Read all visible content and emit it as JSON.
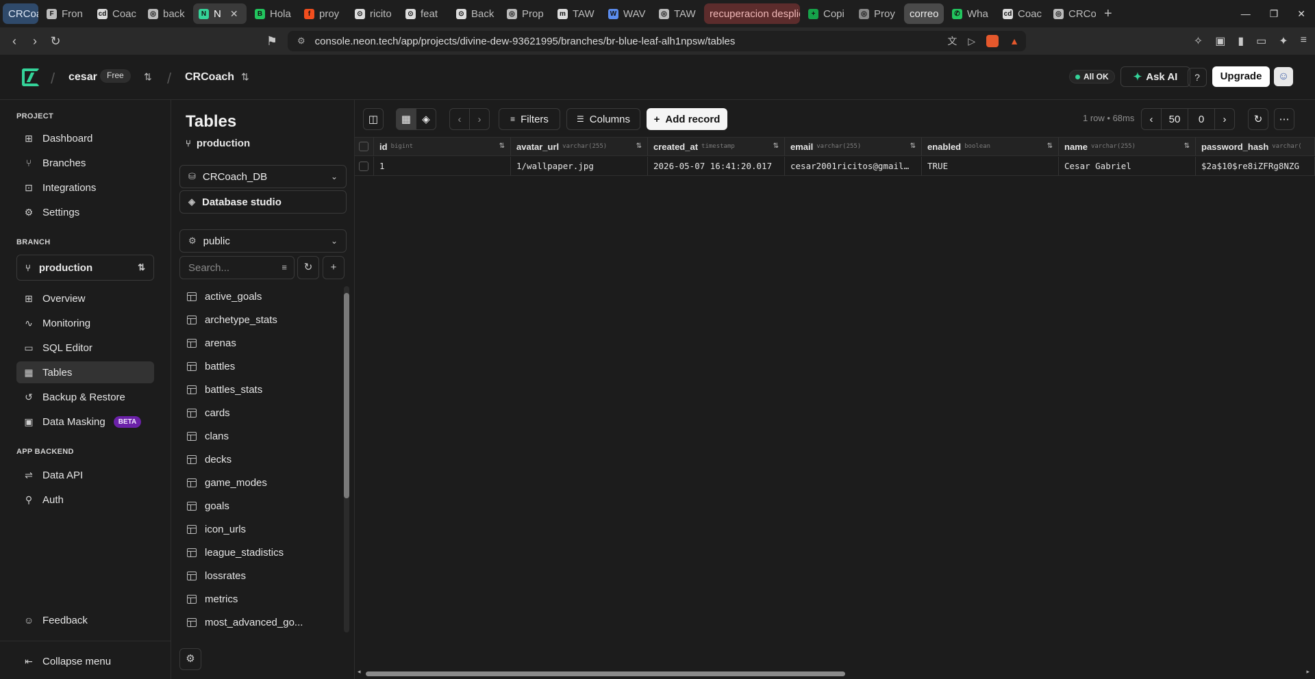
{
  "browser": {
    "tabs": [
      {
        "label": "CRCoach",
        "style": "group-blue",
        "fav": ""
      },
      {
        "label": "Fron",
        "style": "",
        "fav": "F",
        "favColor": "#bbbbbb"
      },
      {
        "label": "Coac",
        "style": "",
        "fav": "cd",
        "favColor": "#dddddd"
      },
      {
        "label": "back",
        "style": "",
        "fav": "◎",
        "favColor": "#bbbbbb"
      },
      {
        "label": "N",
        "style": "active",
        "fav": "N",
        "favColor": "#34d399"
      },
      {
        "label": "Hola",
        "style": "",
        "fav": "B",
        "favColor": "#22c55e"
      },
      {
        "label": "proy",
        "style": "",
        "fav": "f",
        "favColor": "#f24e1e"
      },
      {
        "label": "ricito",
        "style": "",
        "fav": "⊙",
        "favColor": "#dddddd"
      },
      {
        "label": "feat",
        "style": "",
        "fav": "⊙",
        "favColor": "#dddddd"
      },
      {
        "label": "Back",
        "style": "",
        "fav": "⊙",
        "favColor": "#dddddd"
      },
      {
        "label": "Prop",
        "style": "",
        "fav": "◎",
        "favColor": "#bbbbbb"
      },
      {
        "label": "TAW",
        "style": "",
        "fav": "m",
        "favColor": "#dddddd"
      },
      {
        "label": "WAV",
        "style": "",
        "fav": "W",
        "favColor": "#5b8def"
      },
      {
        "label": "TAW",
        "style": "",
        "fav": "◎",
        "favColor": "#bbbbbb"
      },
      {
        "label": "recuperacion desplie",
        "style": "group-red",
        "fav": ""
      },
      {
        "label": "Copi",
        "style": "",
        "fav": "+",
        "favColor": "#16a34a"
      },
      {
        "label": "Proy",
        "style": "",
        "fav": "◎",
        "favColor": "#888888"
      },
      {
        "label": "correo",
        "style": "group-gray",
        "fav": ""
      },
      {
        "label": "Wha",
        "style": "",
        "fav": "✆",
        "favColor": "#22c55e"
      },
      {
        "label": "Coac",
        "style": "",
        "fav": "cd",
        "favColor": "#dddddd"
      },
      {
        "label": "CRCo",
        "style": "",
        "fav": "◎",
        "favColor": "#bbbbbb"
      }
    ],
    "url": "console.neon.tech/app/projects/divine-dew-93621995/branches/br-blue-leaf-alh1npsw/tables"
  },
  "header": {
    "org": "cesar",
    "plan_badge": "Free",
    "project": "CRCoach",
    "status": "All OK",
    "ask_ai": "Ask AI",
    "help": "?",
    "upgrade": "Upgrade"
  },
  "nav": {
    "project_section": "PROJECT",
    "project_items": [
      {
        "label": "Dashboard",
        "icon": "dashboard-icon"
      },
      {
        "label": "Branches",
        "icon": "branch-icon"
      },
      {
        "label": "Integrations",
        "icon": "integrations-icon"
      },
      {
        "label": "Settings",
        "icon": "gear-icon"
      }
    ],
    "branch_section": "BRANCH",
    "branch_selected": "production",
    "branch_items": [
      {
        "label": "Overview",
        "icon": "overview-icon"
      },
      {
        "label": "Monitoring",
        "icon": "monitoring-icon"
      },
      {
        "label": "SQL Editor",
        "icon": "sql-icon"
      },
      {
        "label": "Tables",
        "icon": "table-icon"
      },
      {
        "label": "Backup & Restore",
        "icon": "backup-icon"
      },
      {
        "label": "Data Masking",
        "icon": "mask-icon"
      }
    ],
    "beta_badge": "BETA",
    "backend_section": "APP BACKEND",
    "backend_items": [
      {
        "label": "Data API",
        "icon": "api-icon"
      },
      {
        "label": "Auth",
        "icon": "auth-icon"
      }
    ],
    "feedback": "Feedback",
    "collapse": "Collapse menu"
  },
  "tables_panel": {
    "title": "Tables",
    "branch": "production",
    "database": "CRCoach_DB",
    "studio": "Database studio",
    "schema": "public",
    "search_placeholder": "Search...",
    "tables": [
      "active_goals",
      "archetype_stats",
      "arenas",
      "battles",
      "battles_stats",
      "cards",
      "clans",
      "decks",
      "game_modes",
      "goals",
      "icon_urls",
      "league_stadistics",
      "lossrates",
      "metrics",
      "most_advanced_go..."
    ]
  },
  "toolbar": {
    "filters": "Filters",
    "columns": "Columns",
    "add_record": "Add record",
    "row_info": "1 row • 68ms",
    "limit": "50",
    "offset": "0"
  },
  "grid": {
    "columns": [
      {
        "name": "id",
        "type": "bigint"
      },
      {
        "name": "avatar_url",
        "type": "varchar(255)"
      },
      {
        "name": "created_at",
        "type": "timestamp"
      },
      {
        "name": "email",
        "type": "varchar(255)"
      },
      {
        "name": "enabled",
        "type": "boolean"
      },
      {
        "name": "name",
        "type": "varchar(255)"
      },
      {
        "name": "password_hash",
        "type": "varchar("
      }
    ],
    "rows": [
      [
        "1",
        "1/wallpaper.jpg",
        "2026-05-07 16:41:20.017",
        "cesar2001ricitos@gmail…",
        "TRUE",
        "Cesar Gabriel",
        "$2a$10$re8iZFRg8NZG"
      ]
    ]
  }
}
